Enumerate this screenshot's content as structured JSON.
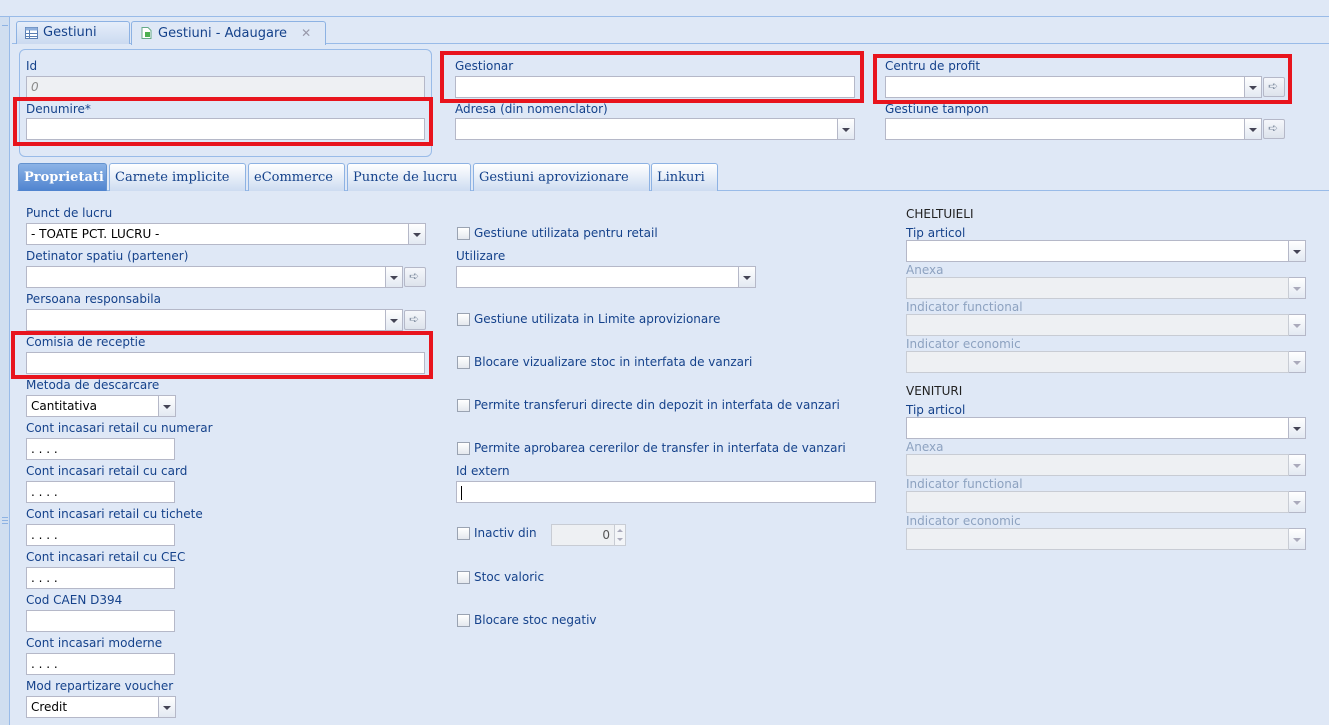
{
  "window_tabs": [
    {
      "label": "Gestiuni",
      "icon": "table-icon"
    },
    {
      "label": "Gestiuni - Adaugare",
      "icon": "add-document-icon",
      "close": "✕"
    }
  ],
  "header": {
    "id_label": "Id",
    "id_value": "0",
    "denumire_label": "Denumire*",
    "denumire_value": "",
    "gestionar_label": "Gestionar",
    "gestionar_value": "",
    "adresa_label": "Adresa (din nomenclator)",
    "adresa_value": "",
    "centru_label": "Centru de profit",
    "centru_value": "",
    "tampon_label": "Gestiune tampon",
    "tampon_value": ""
  },
  "tabs": [
    {
      "label": "Proprietati",
      "active": true
    },
    {
      "label": "Carnete implicite"
    },
    {
      "label": "eCommerce"
    },
    {
      "label": "Puncte de lucru"
    },
    {
      "label": "Gestiuni aprovizionare"
    },
    {
      "label": "Linkuri"
    }
  ],
  "col1": {
    "punct_label": "Punct de lucru",
    "punct_value": "- TOATE PCT. LUCRU -",
    "detinator_label": "Detinator spatiu (partener)",
    "persoana_label": "Persoana responsabila",
    "comisia_label": "Comisia de receptie",
    "metoda_label": "Metoda de descarcare",
    "metoda_value": "Cantitativa",
    "numerar_label": "Cont incasari retail cu numerar",
    "card_label": "Cont incasari retail cu card",
    "tichete_label": "Cont incasari retail cu tichete",
    "cec_label": "Cont incasari retail cu CEC",
    "caen_label": "Cod CAEN D394",
    "moderne_label": "Cont incasari moderne",
    "voucher_label": "Mod repartizare voucher",
    "voucher_value": "Credit",
    "account_mask": " .  .  .  ."
  },
  "col2": {
    "retail_label": "Gestiune utilizata pentru retail",
    "utilizare_label": "Utilizare",
    "limite_label": "Gestiune utilizata in Limite aprovizionare",
    "blocare_viz_label": "Blocare vizualizare stoc in interfata de vanzari",
    "transferuri_label": "Permite transferuri directe din depozit in interfata de vanzari",
    "aprobare_label": "Permite aprobarea cererilor de transfer in interfata de vanzari",
    "idextern_label": "Id extern",
    "inactiv_label": "Inactiv din",
    "inactiv_value": "0",
    "valoric_label": "Stoc valoric",
    "negativ_label": "Blocare stoc negativ"
  },
  "col3": {
    "cheltuieli_title": "CHELTUIELI",
    "venituri_title": "VENITURI",
    "tip_label": "Tip articol",
    "anexa_label": "Anexa",
    "functional_label": "Indicator functional",
    "economic_label": "Indicator economic"
  }
}
